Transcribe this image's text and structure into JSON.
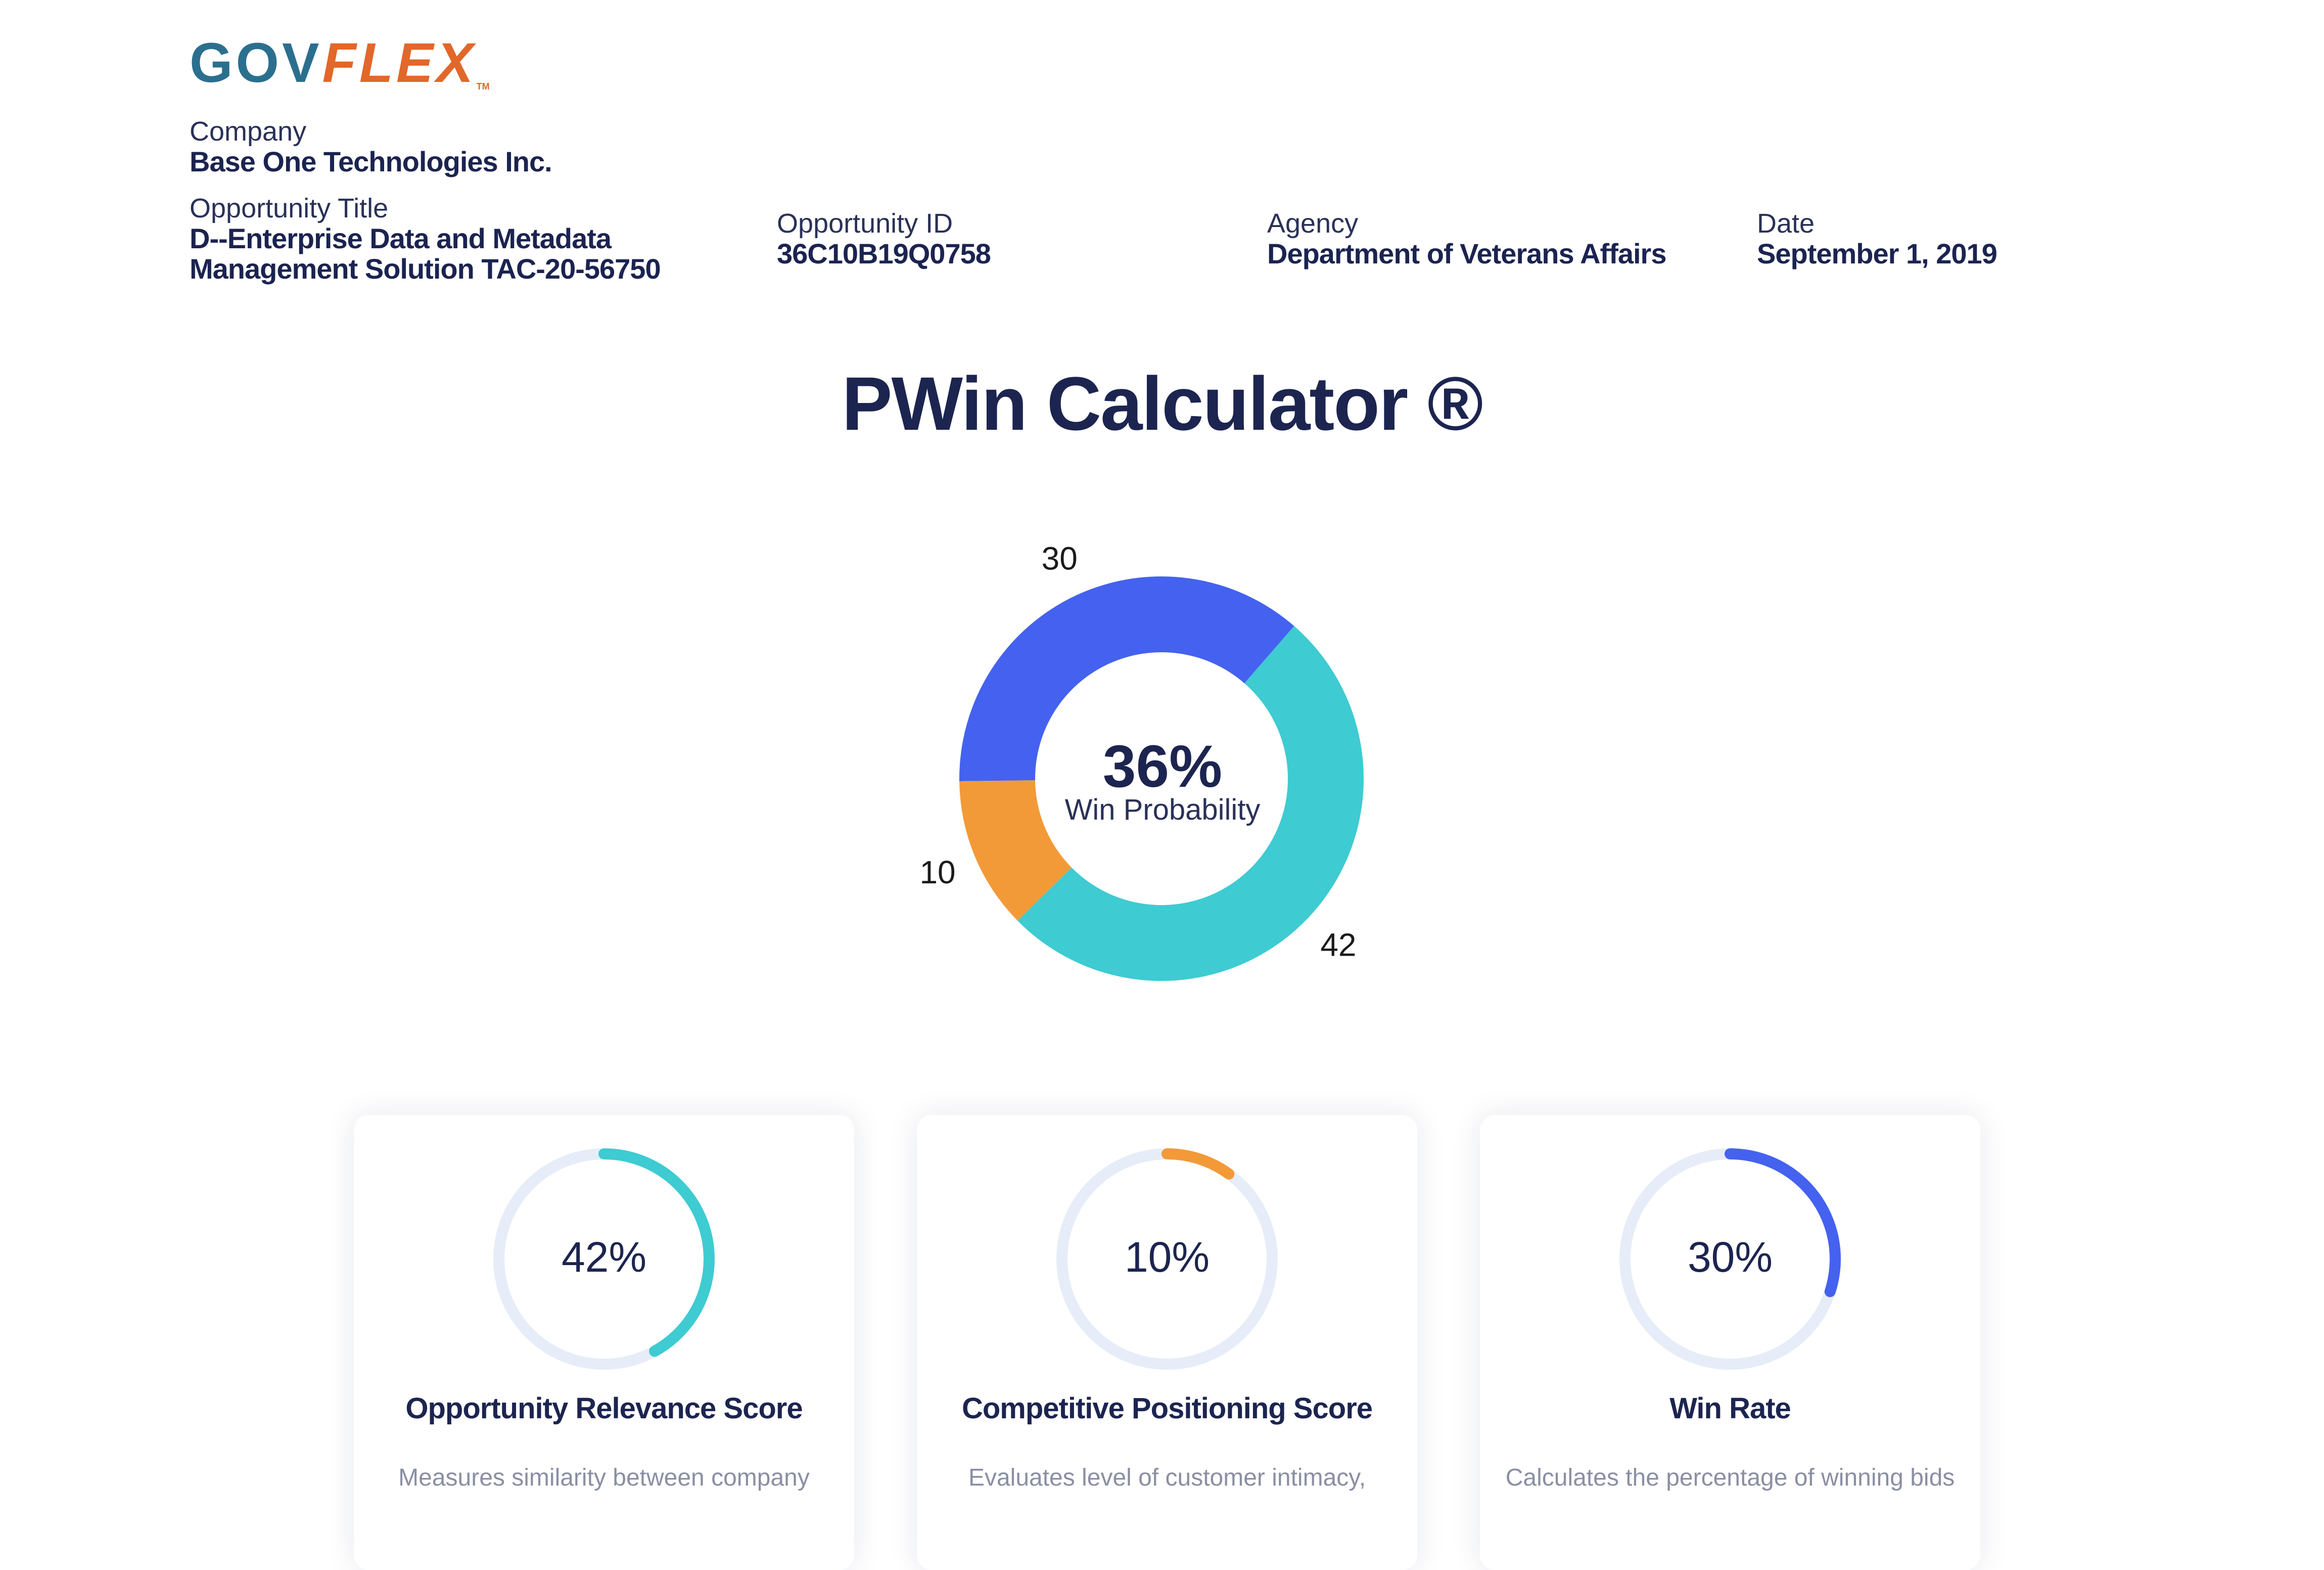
{
  "logo": {
    "part1": "GOV",
    "part2": "FLEX",
    "tm": "TM"
  },
  "header": {
    "company_label": "Company",
    "company_value": "Base One Technologies Inc.",
    "title_label": "Opportunity Title",
    "title_line1": "D--Enterprise Data and Metadata",
    "title_line2": "Management Solution TAC-20-56750",
    "id_label": "Opportunity ID",
    "id_value": "36C10B19Q0758",
    "agency_label": "Agency",
    "agency_value": "Department of Veterans Affairs",
    "date_label": "Date",
    "date_value": "September 1, 2019"
  },
  "page_title": "PWin Calculator ®",
  "chart_data": {
    "type": "pie",
    "donut": true,
    "segments": [
      {
        "label": "42",
        "value": 42,
        "color": "#3ecbd2"
      },
      {
        "label": "10",
        "value": 10,
        "color": "#f39a38"
      },
      {
        "label": "30",
        "value": 30,
        "color": "#4462ef"
      }
    ],
    "center_value": "36%",
    "center_label": "Win Probability"
  },
  "cards": [
    {
      "pct": "42%",
      "value": 42,
      "color": "#3ecbd2",
      "title": "Opportunity Relevance Score",
      "desc": "Measures similarity between company"
    },
    {
      "pct": "10%",
      "value": 10,
      "color": "#f39a38",
      "title": "Competitive Positioning Score",
      "desc": "Evaluates level of customer intimacy,"
    },
    {
      "pct": "30%",
      "value": 30,
      "color": "#4462ef",
      "title": "Win Rate",
      "desc": "Calculates the percentage of winning bids"
    }
  ]
}
